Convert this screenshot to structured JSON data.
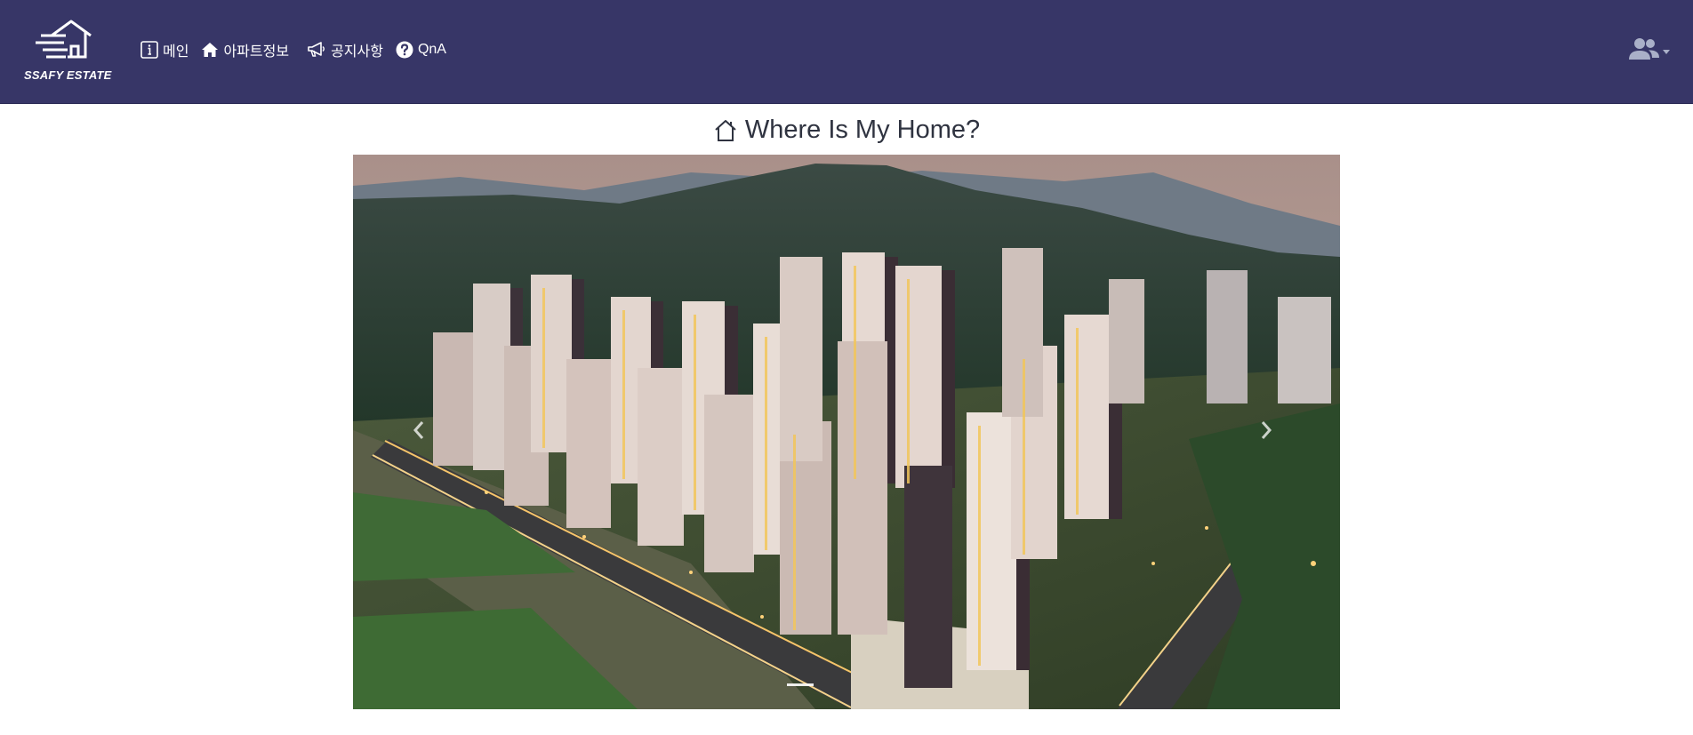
{
  "brand": {
    "name": "SSAFY ESTATE",
    "logo_icon": "house-lines-logo"
  },
  "nav": {
    "items": [
      {
        "label": "메인",
        "icon": "info-icon"
      },
      {
        "label": "아파트정보",
        "icon": "house-icon"
      },
      {
        "label": "공지사항",
        "icon": "megaphone-icon"
      },
      {
        "label": "QnA",
        "icon": "question-circle-icon"
      }
    ]
  },
  "user_menu": {
    "icon": "users-icon"
  },
  "hero": {
    "title": "Where Is My Home?",
    "title_icon": "house-outline-icon"
  },
  "carousel": {
    "image_subject": "aerial-apartment-complex",
    "prev_icon": "chevron-left-icon",
    "next_icon": "chevron-right-icon",
    "slide_count": 1,
    "active_index": 0
  },
  "colors": {
    "navbar_bg": "#373667",
    "title_text": "#2f3340",
    "nav_text": "#ffffff"
  }
}
